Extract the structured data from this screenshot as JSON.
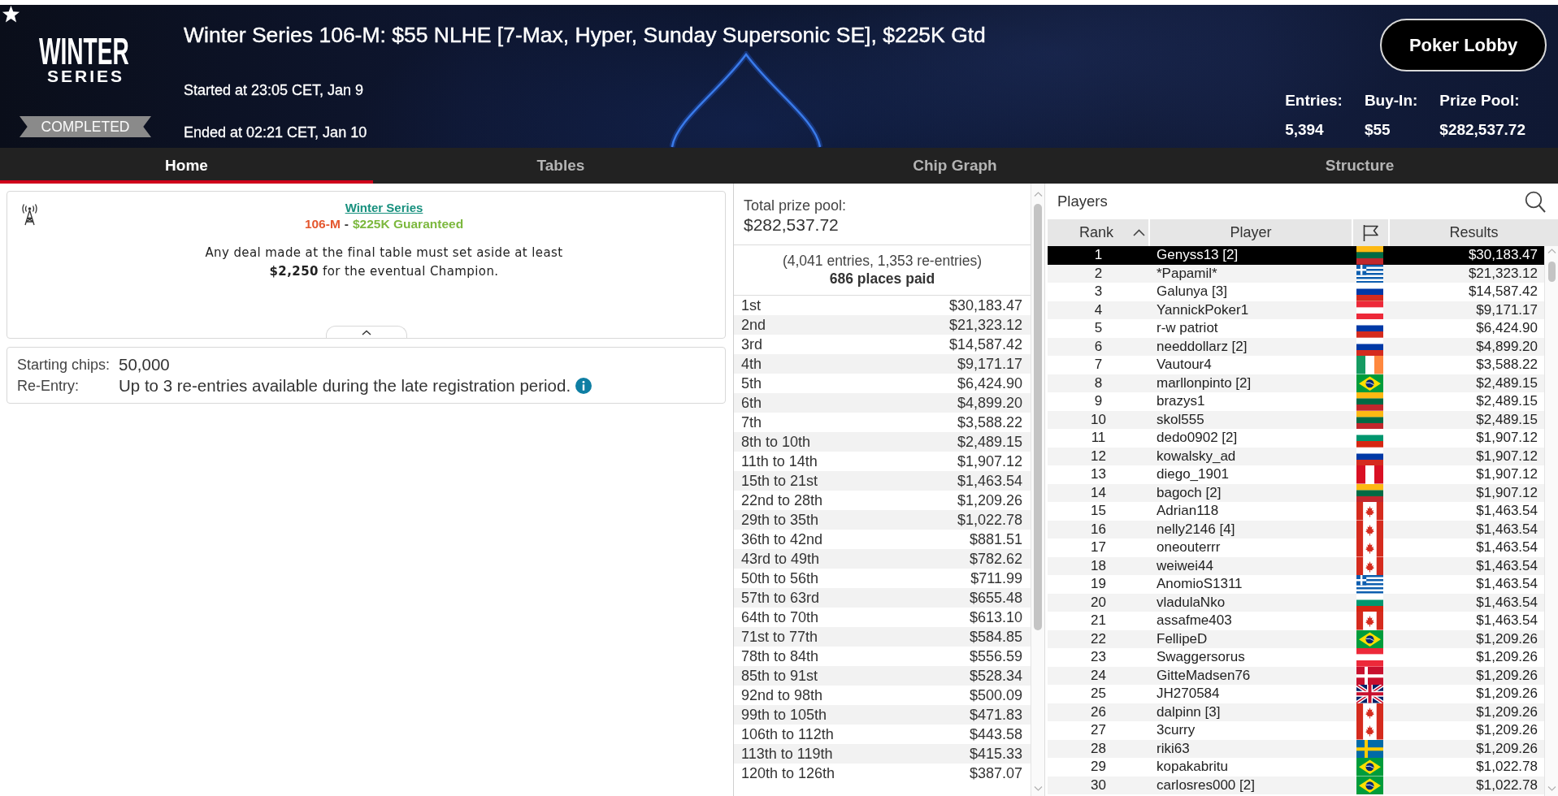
{
  "header": {
    "logo": {
      "title": "WINTER",
      "subtitle": "SERIES"
    },
    "status": "COMPLETED",
    "title": "Winter Series 106-M: $55 NLHE [7-Max, Hyper, Sunday Supersonic SE], $225K Gtd",
    "started": "Started at 23:05 CET, Jan 9",
    "ended": "Ended at 02:21 CET, Jan 10",
    "lobby_button": "Poker Lobby",
    "stats": [
      {
        "label": "Entries:",
        "value": "5,394"
      },
      {
        "label": "Buy-In:",
        "value": "$55"
      },
      {
        "label": "Prize Pool:",
        "value": "$282,537.72"
      }
    ]
  },
  "tabs": [
    {
      "label": "Home",
      "selected": true
    },
    {
      "label": "Tables",
      "selected": false
    },
    {
      "label": "Chip Graph",
      "selected": false
    },
    {
      "label": "Structure",
      "selected": false
    }
  ],
  "info_card": {
    "link": "Winter Series",
    "event_code": "106-M",
    "separator": "-",
    "guarantee": "$225K Guaranteed",
    "notice": "Any deal made at the final table must set aside at least **$2,250** for the eventual Champion.",
    "expanded": true
  },
  "details": [
    {
      "kind": "plain",
      "label": "Starting chips:",
      "value": "50,000"
    },
    {
      "kind": "info",
      "label": "Re-Entry:",
      "value": "Up to 3 re-entries available during the late registration period."
    }
  ],
  "prize_pool": {
    "label": "Total prize pool:",
    "total": "$282,537.72",
    "entries_note": "(4,041 entries, 1,353 re-entries)",
    "places_paid": "686 places paid",
    "payouts": [
      {
        "place": "1st",
        "prize": "$30,183.47"
      },
      {
        "place": "2nd",
        "prize": "$21,323.12"
      },
      {
        "place": "3rd",
        "prize": "$14,587.42"
      },
      {
        "place": "4th",
        "prize": "$9,171.17"
      },
      {
        "place": "5th",
        "prize": "$6,424.90"
      },
      {
        "place": "6th",
        "prize": "$4,899.20"
      },
      {
        "place": "7th",
        "prize": "$3,588.22"
      },
      {
        "place": "8th to 10th",
        "prize": "$2,489.15"
      },
      {
        "place": "11th to 14th",
        "prize": "$1,907.12"
      },
      {
        "place": "15th to 21st",
        "prize": "$1,463.54"
      },
      {
        "place": "22nd to 28th",
        "prize": "$1,209.26"
      },
      {
        "place": "29th to 35th",
        "prize": "$1,022.78"
      },
      {
        "place": "36th to 42nd",
        "prize": "$881.51"
      },
      {
        "place": "43rd to 49th",
        "prize": "$782.62"
      },
      {
        "place": "50th to 56th",
        "prize": "$711.99"
      },
      {
        "place": "57th to 63rd",
        "prize": "$655.48"
      },
      {
        "place": "64th to 70th",
        "prize": "$613.10"
      },
      {
        "place": "71st to 77th",
        "prize": "$584.85"
      },
      {
        "place": "78th to 84th",
        "prize": "$556.59"
      },
      {
        "place": "85th to 91st",
        "prize": "$528.34"
      },
      {
        "place": "92nd to 98th",
        "prize": "$500.09"
      },
      {
        "place": "99th to 105th",
        "prize": "$471.83"
      },
      {
        "place": "106th to 112th",
        "prize": "$443.58"
      },
      {
        "place": "113th to 119th",
        "prize": "$415.33"
      },
      {
        "place": "120th to 126th",
        "prize": "$387.07"
      }
    ]
  },
  "players": {
    "title": "Players",
    "columns": [
      {
        "kind": "text",
        "label": "Rank",
        "sorted": true
      },
      {
        "kind": "text",
        "label": "Player",
        "sorted": false
      },
      {
        "kind": "flag",
        "sorted": false
      },
      {
        "kind": "text",
        "label": "Results",
        "sorted": false
      }
    ],
    "rows": [
      {
        "rank": "1",
        "player": "Genyss13 [2]",
        "flag": {
          "kind": "lt"
        },
        "result": "$30,183.47",
        "selected": true
      },
      {
        "rank": "2",
        "player": "*Papamil*",
        "flag": {
          "kind": "gr"
        },
        "result": "$21,323.12",
        "selected": false
      },
      {
        "rank": "3",
        "player": "Galunya [3]",
        "flag": {
          "kind": "ru"
        },
        "result": "$14,587.42",
        "selected": false
      },
      {
        "rank": "4",
        "player": "YannickPoker1",
        "flag": {
          "kind": "at"
        },
        "result": "$9,171.17",
        "selected": false
      },
      {
        "rank": "5",
        "player": "r-w patriot",
        "flag": {
          "kind": "ru"
        },
        "result": "$6,424.90",
        "selected": false
      },
      {
        "rank": "6",
        "player": "needdollarz [2]",
        "flag": {
          "kind": "ru"
        },
        "result": "$4,899.20",
        "selected": false
      },
      {
        "rank": "7",
        "player": "Vautour4",
        "flag": {
          "kind": "ie"
        },
        "result": "$3,588.22",
        "selected": false
      },
      {
        "rank": "8",
        "player": "marllonpinto [2]",
        "flag": {
          "kind": "br"
        },
        "result": "$2,489.15",
        "selected": false
      },
      {
        "rank": "9",
        "player": "brazys1",
        "flag": {
          "kind": "lt"
        },
        "result": "$2,489.15",
        "selected": false
      },
      {
        "rank": "10",
        "player": "skol555",
        "flag": {
          "kind": "lt"
        },
        "result": "$2,489.15",
        "selected": false
      },
      {
        "rank": "11",
        "player": "dedo0902 [2]",
        "flag": {
          "kind": "bg"
        },
        "result": "$1,907.12",
        "selected": false
      },
      {
        "rank": "12",
        "player": "kowalsky_ad",
        "flag": {
          "kind": "ru"
        },
        "result": "$1,907.12",
        "selected": false
      },
      {
        "rank": "13",
        "player": "diego_1901",
        "flag": {
          "kind": "pe"
        },
        "result": "$1,907.12",
        "selected": false
      },
      {
        "rank": "14",
        "player": "bagoch [2]",
        "flag": {
          "kind": "lt"
        },
        "result": "$1,907.12",
        "selected": false
      },
      {
        "rank": "15",
        "player": "Adrian118",
        "flag": {
          "kind": "ca"
        },
        "result": "$1,463.54",
        "selected": false
      },
      {
        "rank": "16",
        "player": "nelly2146 [4]",
        "flag": {
          "kind": "ca"
        },
        "result": "$1,463.54",
        "selected": false
      },
      {
        "rank": "17",
        "player": "oneouterrr",
        "flag": {
          "kind": "ca"
        },
        "result": "$1,463.54",
        "selected": false
      },
      {
        "rank": "18",
        "player": "weiwei44",
        "flag": {
          "kind": "ca"
        },
        "result": "$1,463.54",
        "selected": false
      },
      {
        "rank": "19",
        "player": "AnomioS1311",
        "flag": {
          "kind": "gr"
        },
        "result": "$1,463.54",
        "selected": false
      },
      {
        "rank": "20",
        "player": "vladulaNko",
        "flag": {
          "kind": "bg"
        },
        "result": "$1,463.54",
        "selected": false
      },
      {
        "rank": "21",
        "player": "assafme403",
        "flag": {
          "kind": "ca"
        },
        "result": "$1,463.54",
        "selected": false
      },
      {
        "rank": "22",
        "player": "FellipeD",
        "flag": {
          "kind": "br"
        },
        "result": "$1,209.26",
        "selected": false
      },
      {
        "rank": "23",
        "player": "Swaggersorus",
        "flag": {
          "kind": "at"
        },
        "result": "$1,209.26",
        "selected": false
      },
      {
        "rank": "24",
        "player": "GitteMadsen76",
        "flag": {
          "kind": "dk"
        },
        "result": "$1,209.26",
        "selected": false
      },
      {
        "rank": "25",
        "player": "JH270584",
        "flag": {
          "kind": "gb"
        },
        "result": "$1,209.26",
        "selected": false
      },
      {
        "rank": "26",
        "player": "dalpinn [3]",
        "flag": {
          "kind": "ca"
        },
        "result": "$1,209.26",
        "selected": false
      },
      {
        "rank": "27",
        "player": "3curry",
        "flag": {
          "kind": "ca"
        },
        "result": "$1,209.26",
        "selected": false
      },
      {
        "rank": "28",
        "player": "riki63",
        "flag": {
          "kind": "se"
        },
        "result": "$1,209.26",
        "selected": false
      },
      {
        "rank": "29",
        "player": "kopakabritu",
        "flag": {
          "kind": "br"
        },
        "result": "$1,022.78",
        "selected": false
      },
      {
        "rank": "30",
        "player": "carlosres000 [2]",
        "flag": {
          "kind": "br"
        },
        "result": "$1,022.78",
        "selected": false
      }
    ]
  }
}
